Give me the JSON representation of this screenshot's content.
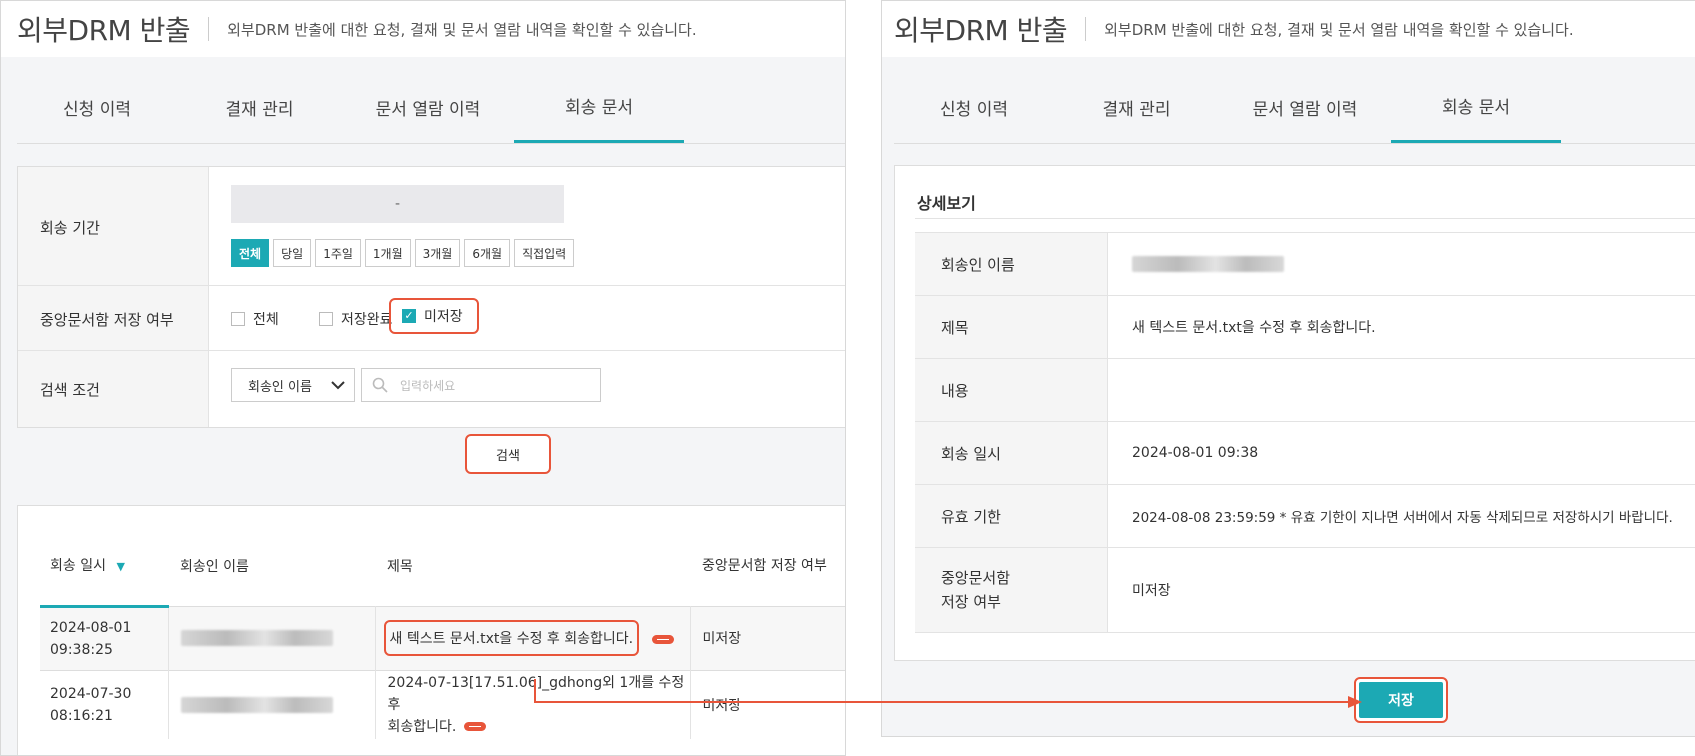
{
  "header": {
    "title": "외부DRM 반출",
    "subtitle": "외부DRM 반출에 대한 요청, 결재 및 문서 열람 내역을 확인할 수 있습니다."
  },
  "tabs": [
    "신청 이력",
    "결재 관리",
    "문서 열람 이력",
    "회송 문서"
  ],
  "filters": {
    "period_label": "회송 기간",
    "date_separator": "-",
    "period_chips": [
      "전체",
      "당일",
      "1주일",
      "1개월",
      "3개월",
      "6개월",
      "직접입력"
    ],
    "storage_label": "중앙문서함 저장 여부",
    "storage_options": [
      "전체",
      "저장완료",
      "미저장"
    ],
    "search_label": "검색 조건",
    "search_field": "회송인 이름",
    "search_placeholder": "입력하세요",
    "search_button": "검색"
  },
  "list": {
    "columns": [
      "회송 일시",
      "회송인 이름",
      "제목",
      "중앙문서함 저장 여부"
    ],
    "rows": [
      {
        "date": "2024-08-01",
        "time": "09:38:25",
        "title": "새 텍스트 문서.txt을 수정 후 회송합니다.",
        "status": "미저장"
      },
      {
        "date": "2024-07-30",
        "time": "08:16:21",
        "title_line1": "2024-07-13[17.51.06]_gdhong외 1개를 수정 후",
        "title_line2": "회송합니다.",
        "status": "미저장"
      }
    ]
  },
  "detail": {
    "heading": "상세보기",
    "labels": {
      "sender": "회송인 이름",
      "title": "제목",
      "content": "내용",
      "returned_at": "회송 일시",
      "expiry": "유효 기한",
      "storage_line1": "중앙문서함",
      "storage_line2": "저장 여부"
    },
    "values": {
      "title": "새 텍스트 문서.txt을 수정 후 회송합니다.",
      "content": "",
      "returned_at": "2024-08-01 09:38",
      "expiry": "2024-08-08 23:59:59 * 유효 기한이 지나면 서버에서 자동 삭제되므로 저장하시기 바랍니다.",
      "storage": "미저장"
    },
    "save_button": "저장"
  },
  "colors": {
    "accent": "#1ca9b4",
    "highlight": "#e8553a"
  }
}
